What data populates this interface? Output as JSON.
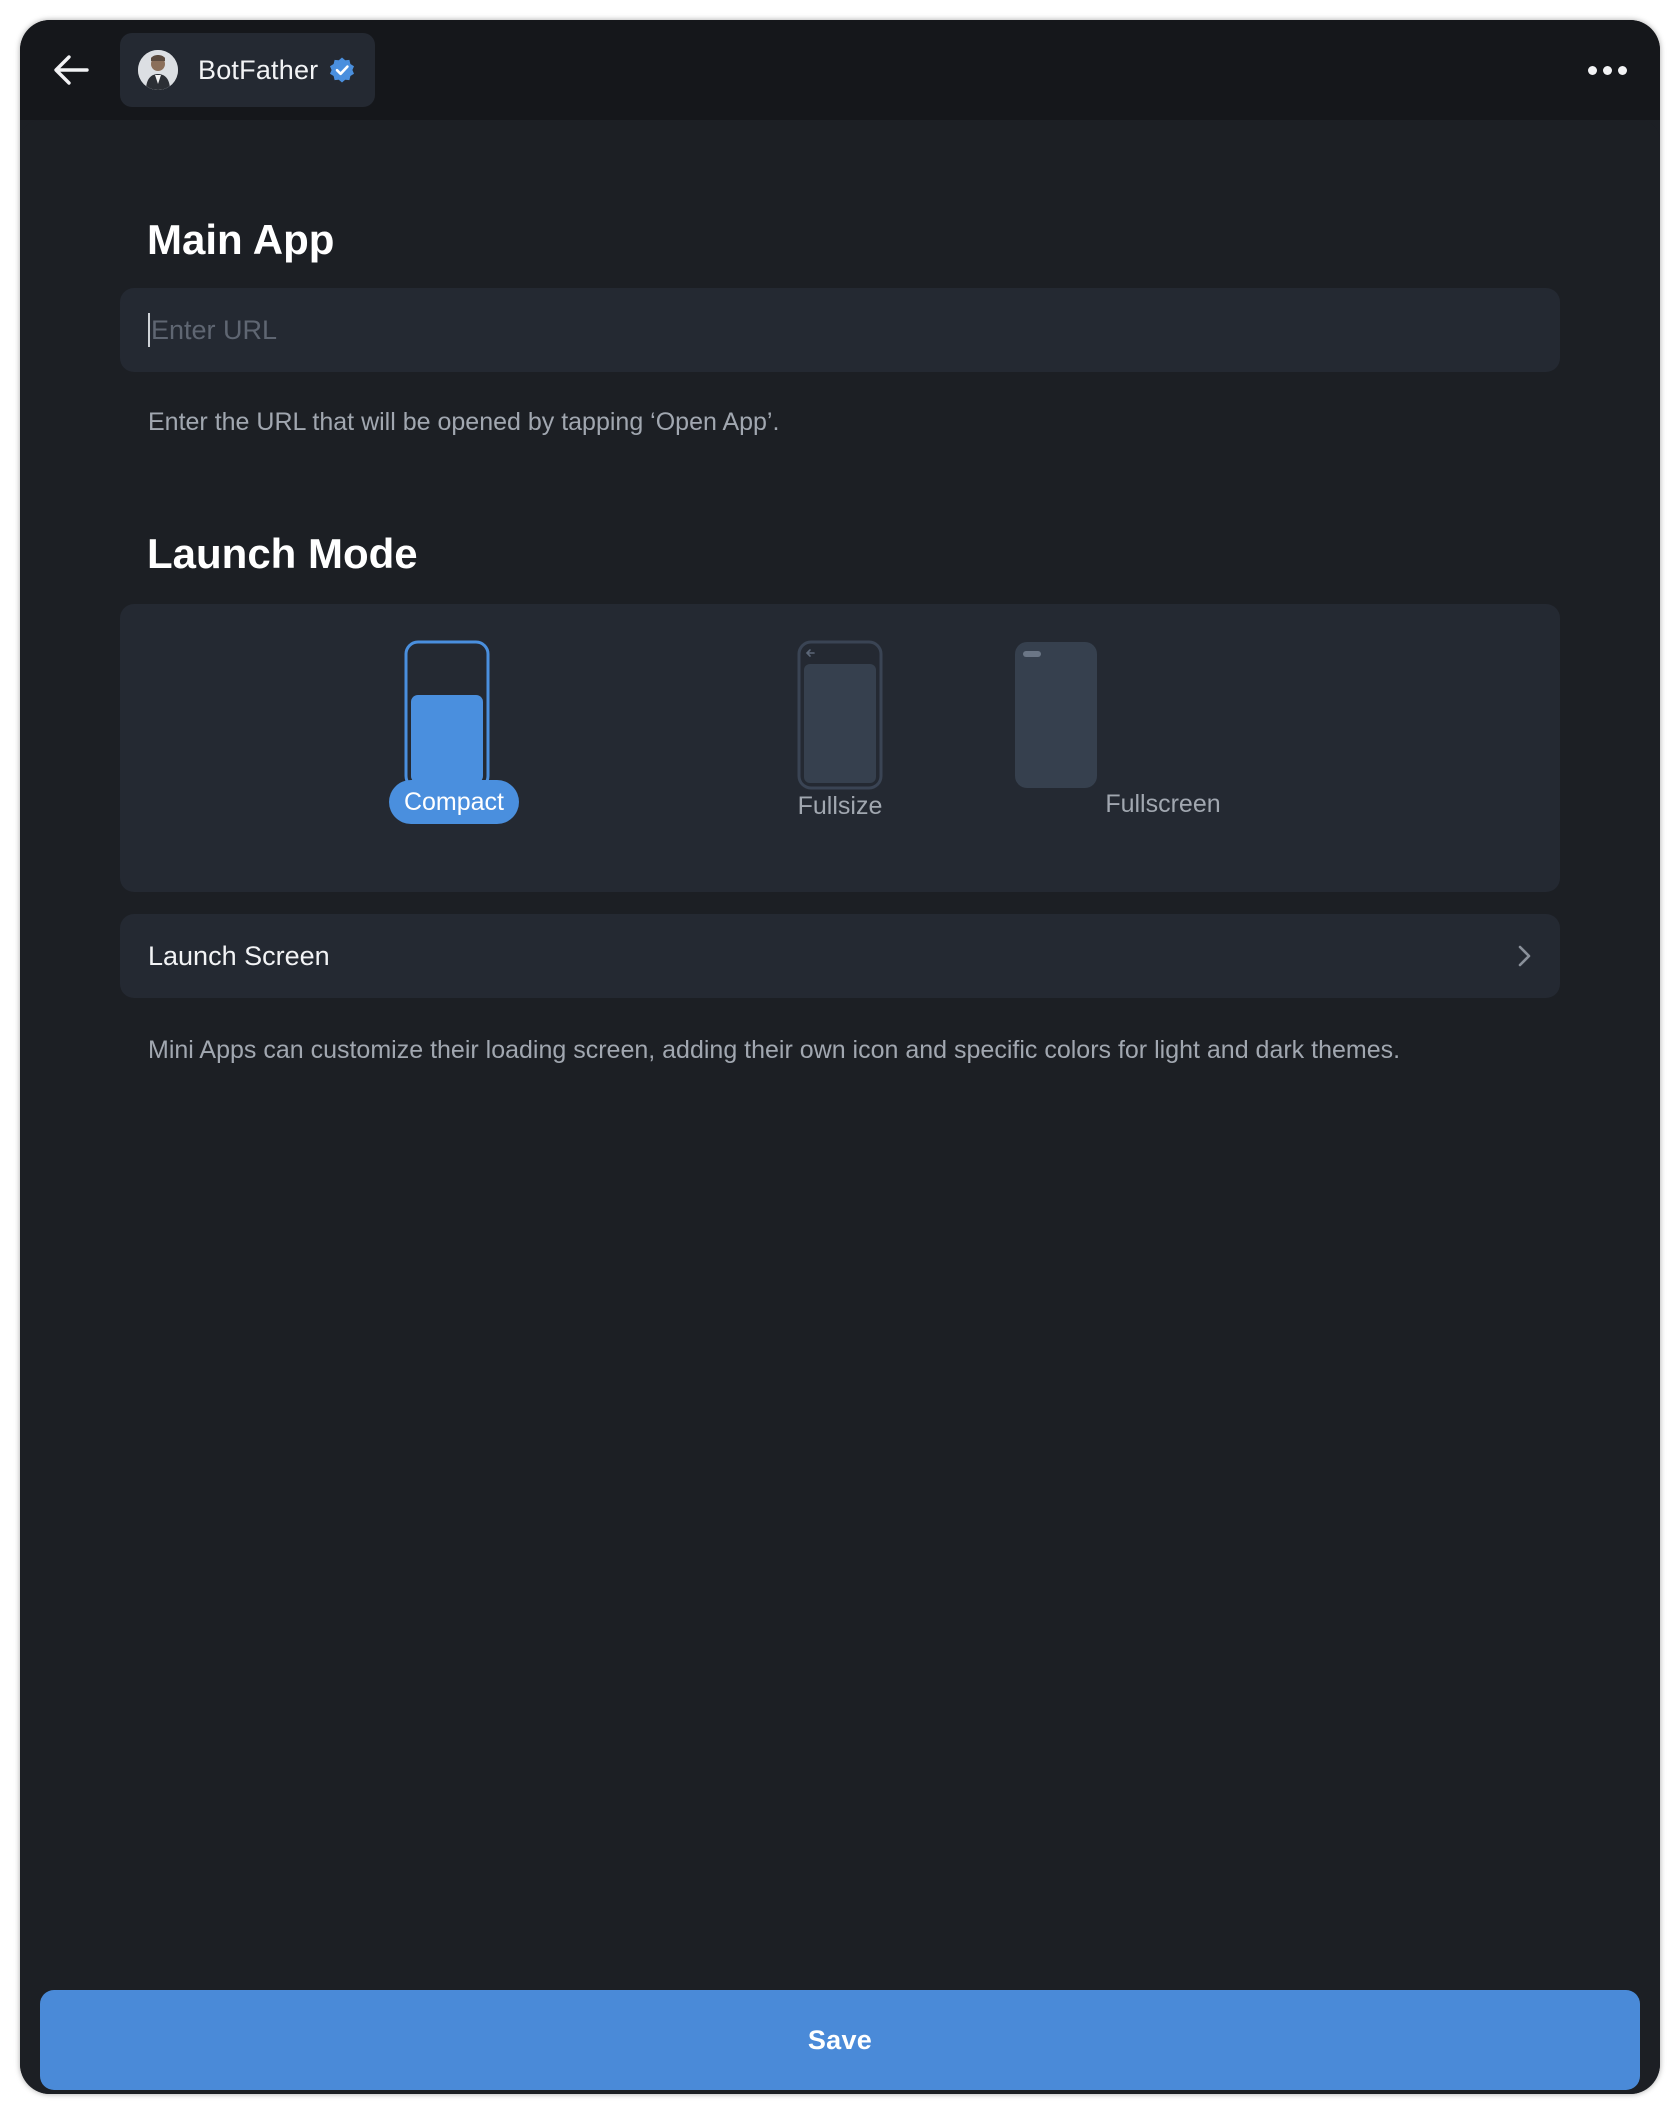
{
  "header": {
    "chat_title": "BotFather",
    "back_icon": "arrow-left-icon",
    "verified_icon": "verified-badge-icon",
    "more_icon": "more-dots-icon"
  },
  "main_app": {
    "title": "Main App",
    "url_value": "",
    "url_placeholder": "Enter URL",
    "hint": "Enter the URL that will be opened by tapping ‘Open App’."
  },
  "launch_mode": {
    "title": "Launch Mode",
    "selected": "Compact",
    "options": [
      {
        "label": "Compact",
        "icon": "compact-phone-icon"
      },
      {
        "label": "Fullsize",
        "icon": "fullsize-phone-icon"
      },
      {
        "label": "Fullscreen",
        "icon": "fullscreen-phone-icon"
      }
    ]
  },
  "launch_screen": {
    "label": "Launch Screen",
    "hint": "Mini Apps can customize their loading screen, adding their own icon and specific colors for light and dark themes."
  },
  "footer": {
    "save_label": "Save"
  },
  "colors": {
    "accent": "#4a8fde",
    "background": "#1c1f24",
    "surface": "#242932",
    "topbar": "#15171b"
  }
}
